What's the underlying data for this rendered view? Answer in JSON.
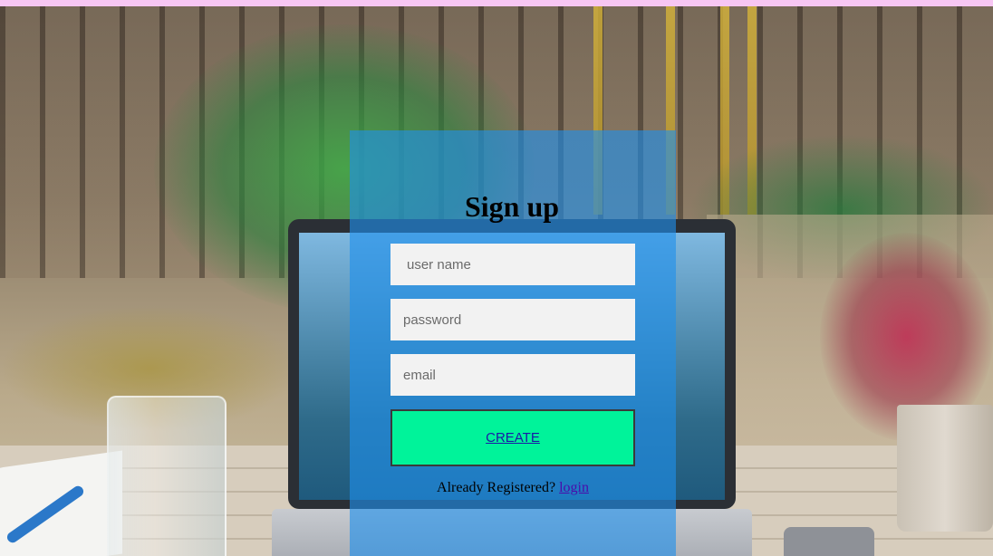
{
  "form": {
    "title": "Sign up",
    "username_placeholder": "user name",
    "password_placeholder": "password",
    "email_placeholder": "email",
    "create_label": "CREATE",
    "already_text": "Already Registered?",
    "login_label": "login"
  },
  "colors": {
    "top_bar": "#f7c6f3",
    "panel": "#1e90eb",
    "create_button": "#00f39a",
    "field_background": "#f2f2f2"
  }
}
